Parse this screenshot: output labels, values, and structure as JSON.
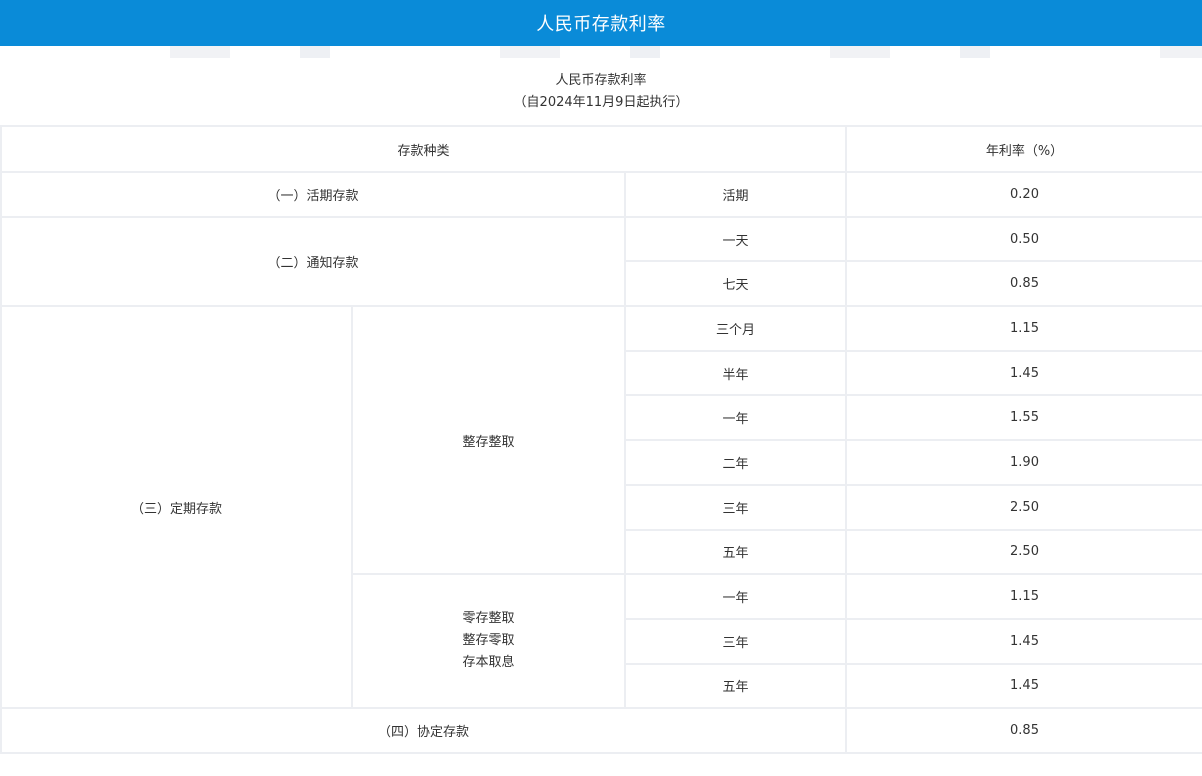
{
  "header": {
    "title": "人民币存款利率"
  },
  "caption": {
    "line1": "人民币存款利率",
    "line2": "（自2024年11月9日起执行）"
  },
  "table": {
    "headers": {
      "type": "存款种类",
      "rate": "年利率（%）"
    },
    "demand": {
      "label": "（一）活期存款",
      "term": "活期",
      "rate": "0.20"
    },
    "notice": {
      "label": "（二）通知存款",
      "rows": [
        {
          "term": "一天",
          "rate": "0.50"
        },
        {
          "term": "七天",
          "rate": "0.85"
        }
      ]
    },
    "fixed": {
      "label": "（三）定期存款",
      "lump": {
        "label": "整存整取",
        "rows": [
          {
            "term": "三个月",
            "rate": "1.15"
          },
          {
            "term": "半年",
            "rate": "1.45"
          },
          {
            "term": "一年",
            "rate": "1.55"
          },
          {
            "term": "二年",
            "rate": "1.90"
          },
          {
            "term": "三年",
            "rate": "2.50"
          },
          {
            "term": "五年",
            "rate": "2.50"
          }
        ]
      },
      "installment": {
        "labels": [
          "零存整取",
          "整存零取",
          "存本取息"
        ],
        "rows": [
          {
            "term": "一年",
            "rate": "1.15"
          },
          {
            "term": "三年",
            "rate": "1.45"
          },
          {
            "term": "五年",
            "rate": "1.45"
          }
        ]
      }
    },
    "agreement": {
      "label": "（四）协定存款",
      "rate": "0.85"
    }
  }
}
